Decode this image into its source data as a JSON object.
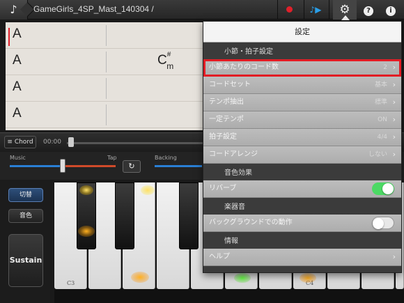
{
  "topbar": {
    "note_icon": "music-note-icon",
    "song_title": "GameGirls_4SP_Mast_140304 /",
    "record_icon": "record-icon",
    "play_icon": "play-arrows-icon",
    "settings_icon": "gear-icon",
    "help_icon": "help-icon",
    "info_icon": "info-icon"
  },
  "chord_chart": {
    "rows": [
      {
        "chords": [
          "A",
          ""
        ]
      },
      {
        "chords": [
          "A",
          "C#m"
        ]
      },
      {
        "chords": [
          "A",
          ""
        ]
      },
      {
        "chords": [
          "A",
          ""
        ]
      }
    ],
    "cm_root": "C",
    "cm_sharp": "#",
    "cm_minor": "m"
  },
  "transport": {
    "chord_tab": "≡ Chord",
    "time": "00:00",
    "position_fraction": 0.03
  },
  "mixer": {
    "music_label": "Music",
    "tap_label": "Tap",
    "backing_label": "Backing",
    "loop_icon": "loop-icon"
  },
  "left_panel": {
    "switch_label": "切替",
    "tone_label": "音色",
    "sustain_label": "Sustain"
  },
  "keyboard": {
    "c3_label": "C3",
    "c4_label": "C4"
  },
  "settings": {
    "title": "設定",
    "section_measure": "小節・拍子設定",
    "rows_measure": [
      {
        "label": "小節あたりのコード数",
        "value": "2"
      },
      {
        "label": "コードセット",
        "value": "基本"
      },
      {
        "label": "テンポ抽出",
        "value": "標準"
      },
      {
        "label": "一定テンポ",
        "value": "ON"
      },
      {
        "label": "拍子設定",
        "value": "4/4"
      },
      {
        "label": "コードアレンジ",
        "value": "しない"
      }
    ],
    "section_effect": "音色効果",
    "reverb_label": "リバーブ",
    "reverb_on": true,
    "section_instrument": "楽器音",
    "background_label": "バックグラウンドでの動作",
    "background_on": false,
    "section_info": "情報",
    "help_label": "ヘルプ"
  },
  "colors": {
    "accent_blue": "#2a7fd4",
    "record_red": "#e0202a",
    "highlight_red": "#e21c24",
    "toggle_green": "#4cd964"
  }
}
